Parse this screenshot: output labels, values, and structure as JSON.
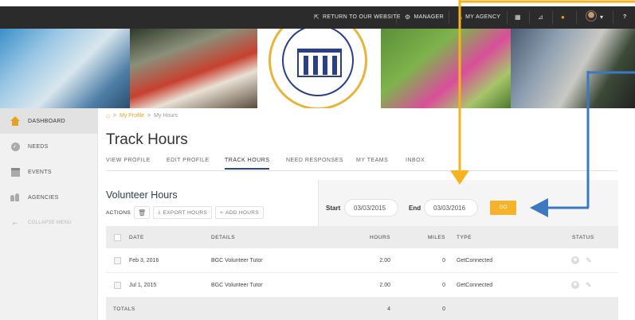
{
  "topbar": {
    "links": [
      {
        "label": "RETURN TO OUR WEBSITE",
        "icon": "external-link-icon"
      },
      {
        "label": "MANAGER",
        "icon": "settings-icon"
      },
      {
        "label": "MY AGENCY",
        "icon": "agency-icon"
      }
    ],
    "help": "?"
  },
  "breadcrumb": {
    "home_icon": "home-icon",
    "items": [
      "My Profile",
      "My Hours"
    ],
    "separator": ">"
  },
  "sidebar": {
    "items": [
      {
        "label": "DASHBOARD",
        "icon": "home-icon"
      },
      {
        "label": "NEEDS",
        "icon": "check-circle-icon"
      },
      {
        "label": "EVENTS",
        "icon": "calendar-icon"
      },
      {
        "label": "AGENCIES",
        "icon": "people-icon"
      },
      {
        "label": "COLLAPSE MENU",
        "icon": "collapse-icon"
      }
    ]
  },
  "page": {
    "title": "Track Hours",
    "tabs": [
      "VIEW PROFILE",
      "EDIT PROFILE",
      "TRACK HOURS",
      "NEED RESPONSES",
      "MY TEAMS",
      "INBOX"
    ],
    "active_tab": "TRACK HOURS"
  },
  "panel": {
    "title": "Volunteer Hours",
    "actions_label": "ACTIONS",
    "export_label": "EXPORT HOURS",
    "add_label": "ADD HOURS"
  },
  "filter": {
    "start_label": "Start",
    "start_value": "03/03/2015",
    "end_label": "End",
    "end_value": "03/03/2016",
    "go_label": "GO"
  },
  "table": {
    "headers": {
      "date": "DATE",
      "details": "DETAILS",
      "hours": "HOURS",
      "miles": "MILES",
      "type": "TYPE",
      "status": "STATUS"
    },
    "rows": [
      {
        "date": "Feb 3, 2016",
        "details": "BGC Volunteer Tutor",
        "hours": "2.00",
        "miles": "0",
        "type": "GetConnected"
      },
      {
        "date": "Jul 1, 2015",
        "details": "BGC Volunteer Tutor",
        "hours": "2.00",
        "miles": "0",
        "type": "GetConnected"
      }
    ],
    "totals": {
      "label": "TOTALS",
      "hours": "4",
      "miles": "0"
    }
  },
  "colors": {
    "accent": "#f5b32c",
    "arrow_orange": "#f7b21f",
    "arrow_blue": "#3d78c3",
    "topbar": "#2b2b2b"
  }
}
